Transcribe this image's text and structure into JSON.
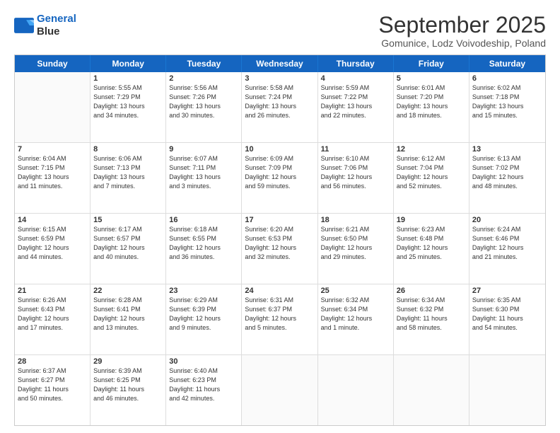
{
  "logo": {
    "line1": "General",
    "line2": "Blue"
  },
  "title": "September 2025",
  "subtitle": "Gomunice, Lodz Voivodeship, Poland",
  "header_days": [
    "Sunday",
    "Monday",
    "Tuesday",
    "Wednesday",
    "Thursday",
    "Friday",
    "Saturday"
  ],
  "weeks": [
    [
      {
        "day": "",
        "info": ""
      },
      {
        "day": "1",
        "info": "Sunrise: 5:55 AM\nSunset: 7:29 PM\nDaylight: 13 hours\nand 34 minutes."
      },
      {
        "day": "2",
        "info": "Sunrise: 5:56 AM\nSunset: 7:26 PM\nDaylight: 13 hours\nand 30 minutes."
      },
      {
        "day": "3",
        "info": "Sunrise: 5:58 AM\nSunset: 7:24 PM\nDaylight: 13 hours\nand 26 minutes."
      },
      {
        "day": "4",
        "info": "Sunrise: 5:59 AM\nSunset: 7:22 PM\nDaylight: 13 hours\nand 22 minutes."
      },
      {
        "day": "5",
        "info": "Sunrise: 6:01 AM\nSunset: 7:20 PM\nDaylight: 13 hours\nand 18 minutes."
      },
      {
        "day": "6",
        "info": "Sunrise: 6:02 AM\nSunset: 7:18 PM\nDaylight: 13 hours\nand 15 minutes."
      }
    ],
    [
      {
        "day": "7",
        "info": "Sunrise: 6:04 AM\nSunset: 7:15 PM\nDaylight: 13 hours\nand 11 minutes."
      },
      {
        "day": "8",
        "info": "Sunrise: 6:06 AM\nSunset: 7:13 PM\nDaylight: 13 hours\nand 7 minutes."
      },
      {
        "day": "9",
        "info": "Sunrise: 6:07 AM\nSunset: 7:11 PM\nDaylight: 13 hours\nand 3 minutes."
      },
      {
        "day": "10",
        "info": "Sunrise: 6:09 AM\nSunset: 7:09 PM\nDaylight: 12 hours\nand 59 minutes."
      },
      {
        "day": "11",
        "info": "Sunrise: 6:10 AM\nSunset: 7:06 PM\nDaylight: 12 hours\nand 56 minutes."
      },
      {
        "day": "12",
        "info": "Sunrise: 6:12 AM\nSunset: 7:04 PM\nDaylight: 12 hours\nand 52 minutes."
      },
      {
        "day": "13",
        "info": "Sunrise: 6:13 AM\nSunset: 7:02 PM\nDaylight: 12 hours\nand 48 minutes."
      }
    ],
    [
      {
        "day": "14",
        "info": "Sunrise: 6:15 AM\nSunset: 6:59 PM\nDaylight: 12 hours\nand 44 minutes."
      },
      {
        "day": "15",
        "info": "Sunrise: 6:17 AM\nSunset: 6:57 PM\nDaylight: 12 hours\nand 40 minutes."
      },
      {
        "day": "16",
        "info": "Sunrise: 6:18 AM\nSunset: 6:55 PM\nDaylight: 12 hours\nand 36 minutes."
      },
      {
        "day": "17",
        "info": "Sunrise: 6:20 AM\nSunset: 6:53 PM\nDaylight: 12 hours\nand 32 minutes."
      },
      {
        "day": "18",
        "info": "Sunrise: 6:21 AM\nSunset: 6:50 PM\nDaylight: 12 hours\nand 29 minutes."
      },
      {
        "day": "19",
        "info": "Sunrise: 6:23 AM\nSunset: 6:48 PM\nDaylight: 12 hours\nand 25 minutes."
      },
      {
        "day": "20",
        "info": "Sunrise: 6:24 AM\nSunset: 6:46 PM\nDaylight: 12 hours\nand 21 minutes."
      }
    ],
    [
      {
        "day": "21",
        "info": "Sunrise: 6:26 AM\nSunset: 6:43 PM\nDaylight: 12 hours\nand 17 minutes."
      },
      {
        "day": "22",
        "info": "Sunrise: 6:28 AM\nSunset: 6:41 PM\nDaylight: 12 hours\nand 13 minutes."
      },
      {
        "day": "23",
        "info": "Sunrise: 6:29 AM\nSunset: 6:39 PM\nDaylight: 12 hours\nand 9 minutes."
      },
      {
        "day": "24",
        "info": "Sunrise: 6:31 AM\nSunset: 6:37 PM\nDaylight: 12 hours\nand 5 minutes."
      },
      {
        "day": "25",
        "info": "Sunrise: 6:32 AM\nSunset: 6:34 PM\nDaylight: 12 hours\nand 1 minute."
      },
      {
        "day": "26",
        "info": "Sunrise: 6:34 AM\nSunset: 6:32 PM\nDaylight: 11 hours\nand 58 minutes."
      },
      {
        "day": "27",
        "info": "Sunrise: 6:35 AM\nSunset: 6:30 PM\nDaylight: 11 hours\nand 54 minutes."
      }
    ],
    [
      {
        "day": "28",
        "info": "Sunrise: 6:37 AM\nSunset: 6:27 PM\nDaylight: 11 hours\nand 50 minutes."
      },
      {
        "day": "29",
        "info": "Sunrise: 6:39 AM\nSunset: 6:25 PM\nDaylight: 11 hours\nand 46 minutes."
      },
      {
        "day": "30",
        "info": "Sunrise: 6:40 AM\nSunset: 6:23 PM\nDaylight: 11 hours\nand 42 minutes."
      },
      {
        "day": "",
        "info": ""
      },
      {
        "day": "",
        "info": ""
      },
      {
        "day": "",
        "info": ""
      },
      {
        "day": "",
        "info": ""
      }
    ]
  ]
}
